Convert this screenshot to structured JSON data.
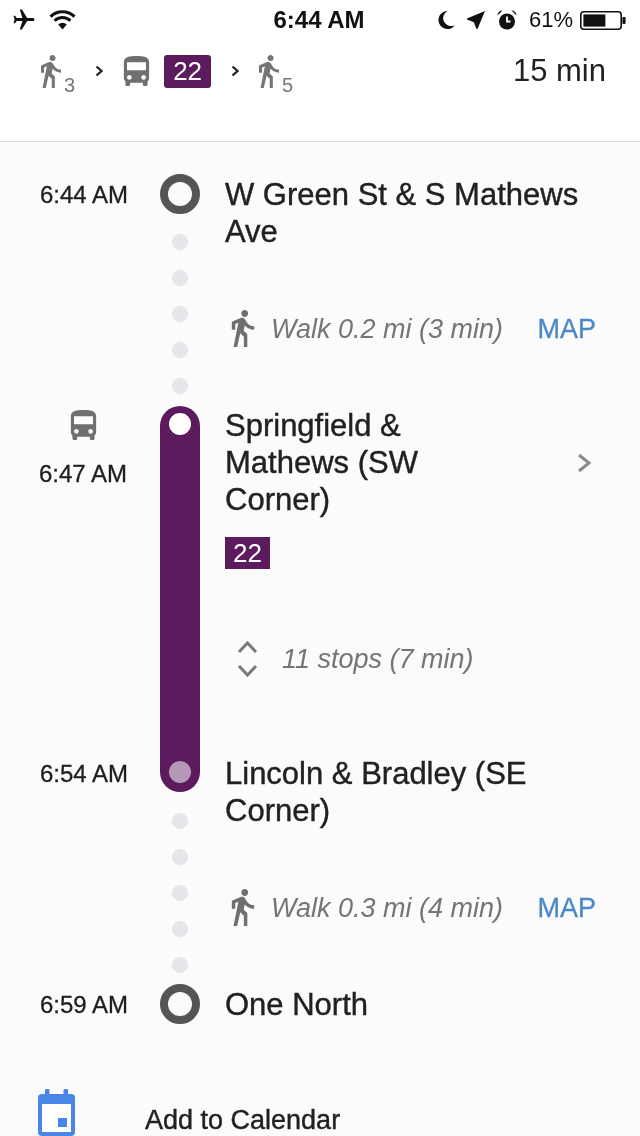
{
  "status_bar": {
    "time": "6:44 AM",
    "battery": "61%"
  },
  "summary": {
    "legs": [
      {
        "kind": "walk",
        "minutes": "3"
      },
      {
        "kind": "bus",
        "route": "22",
        "color": "#5c1b5c"
      },
      {
        "kind": "walk",
        "minutes": "5"
      }
    ],
    "duration": "15 min"
  },
  "itinerary": [
    {
      "kind": "stop",
      "time": "6:44 AM",
      "name": "W Green St & S Mathews Ave"
    },
    {
      "kind": "walk",
      "text": "Walk 0.2 mi (3 min)",
      "link": "MAP"
    },
    {
      "kind": "transit",
      "color": "#5c1b5c",
      "board": {
        "time": "6:47 AM",
        "name": "Springfield & Mathews (SW Corner)"
      },
      "route": "22",
      "stops": "11 stops (7 min)",
      "alight": {
        "time": "6:54 AM",
        "name": "Lincoln & Bradley (SE Corner)"
      }
    },
    {
      "kind": "walk",
      "text": "Walk 0.3 mi (4 min)",
      "link": "MAP"
    },
    {
      "kind": "stop",
      "time": "6:59 AM",
      "name": "One North"
    }
  ],
  "calendar_action": "Add to Calendar"
}
